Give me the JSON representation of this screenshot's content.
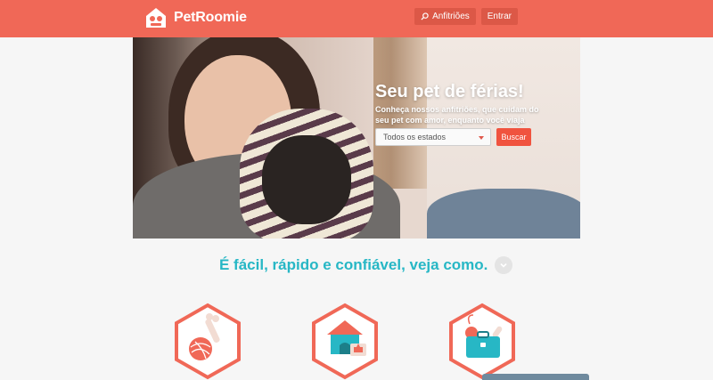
{
  "brand": {
    "name": "PetRoomie",
    "accent": "#f06857",
    "teal": "#27b7c5"
  },
  "nav": {
    "hosts_label": "Anfitriões",
    "hosts_icon": "search-icon",
    "login_label": "Entrar"
  },
  "hero": {
    "title": "Seu pet de férias!",
    "subtitle": "Conheça nossos anfitriões, que cuidam do seu pet com amor, enquanto você viaja",
    "state_select_value": "Todos os estados",
    "search_label": "Buscar"
  },
  "how": {
    "tagline": "É fácil, rápido e confiável, veja como.",
    "chevron_icon": "chevron-down-icon",
    "steps": [
      {
        "icon": "yarn-bone-icon"
      },
      {
        "icon": "doghouse-like-icon"
      },
      {
        "icon": "suitcase-icon"
      }
    ]
  }
}
